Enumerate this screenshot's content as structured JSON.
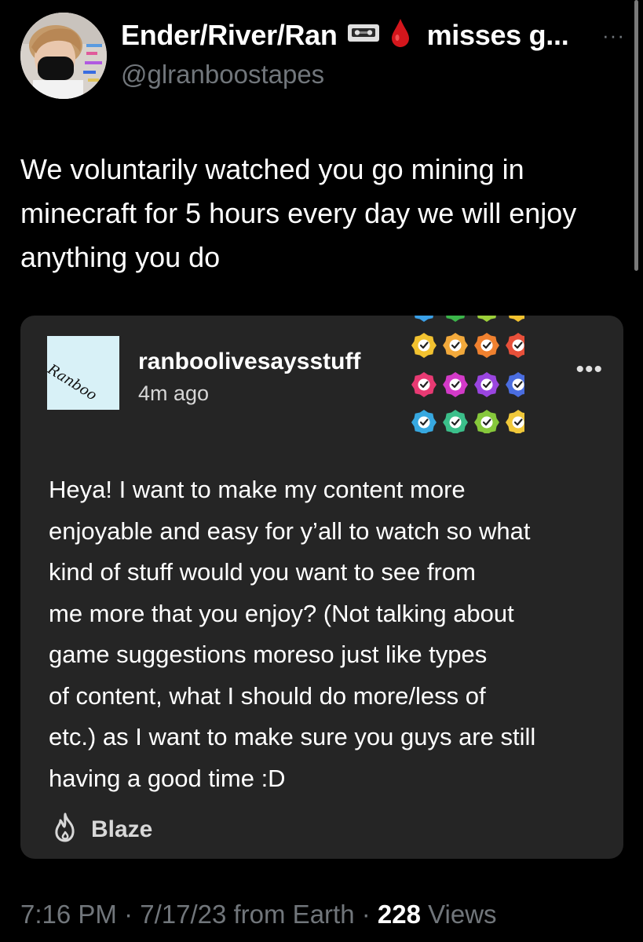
{
  "tweet": {
    "display_name": "Ender/River/Ran",
    "name_emojis": [
      "videocassette-icon",
      "drop-of-blood-icon"
    ],
    "name_suffix": "misses g...",
    "handle": "@glranboostapes",
    "more_label": "···",
    "text": "We voluntarily watched you go mining in minecraft for 5 hours every day we will enjoy anything you do"
  },
  "quote": {
    "avatar_text": "Ranboo",
    "username": "ranboolivesaysstuff",
    "time": "4m ago",
    "more_label": "•••",
    "badge_icons": "verified-checkmark-badge-grid-icon",
    "body": "Heya! I want to make my content more\nenjoyable and easy for y’all to watch so what\nkind of stuff would you want to see from\nme more that you enjoy? (Not talking about\ngame suggestions moreso just like types\nof content, what I should do more/less of\netc.) as I want to make sure you guys are still\nhaving a good time :D",
    "blaze_label": "Blaze"
  },
  "meta": {
    "time": "7:16 PM",
    "separator": " · ",
    "date": "7/17/23",
    "source": " from Earth",
    "views_count": "228",
    "views_label": " Views"
  },
  "colors": {
    "background": "#000000",
    "card_background": "#252525",
    "secondary_text": "#71767b",
    "primary_text": "#ffffff",
    "badge_colors": [
      "#3aa0e8",
      "#3bb54a",
      "#9bcf3a",
      "#f2c230",
      "#f2a93b",
      "#f0812f",
      "#e8503a",
      "#e83a73",
      "#d33ac8",
      "#9a45e0",
      "#4a6de0",
      "#37a8e0",
      "#3bbf8a",
      "#86c83b",
      "#f0c83a"
    ]
  }
}
